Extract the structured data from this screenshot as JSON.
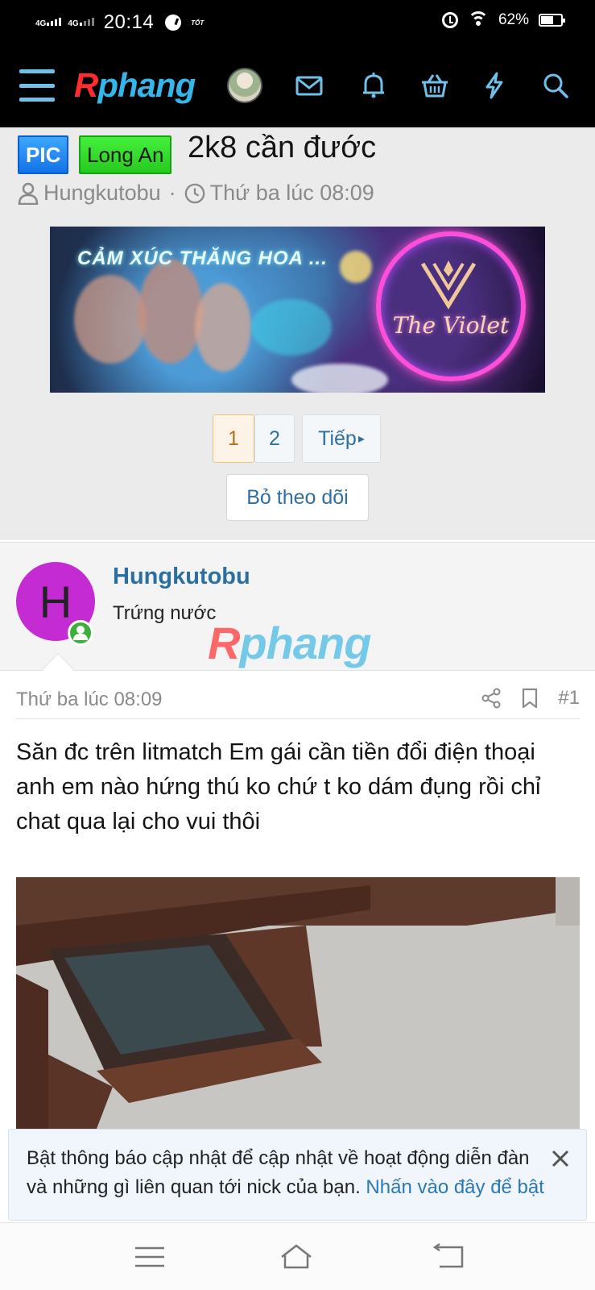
{
  "status_bar": {
    "network_1": "4G",
    "network_2": "4G",
    "time": "20:14",
    "carrier_label": "TỐT",
    "battery_percent": "62%",
    "battery_level": 0.62,
    "icons": [
      "signal-icon",
      "signal-icon",
      "messenger-icon",
      "alarm-icon",
      "wifi-icon",
      "battery-icon"
    ]
  },
  "topnav": {
    "logo_first": "R",
    "logo_rest": "phang",
    "icons": [
      "menu-icon",
      "avatar",
      "mail-icon",
      "bell-icon",
      "basket-icon",
      "lightning-icon",
      "search-icon"
    ],
    "accent_color": "#6fc1ea"
  },
  "thread": {
    "prefix_1": "PIC",
    "prefix_2": "Long An",
    "title": "2k8 cần đước",
    "author": "Hungkutobu",
    "separator": "·",
    "date": "Thứ ba lúc 08:09"
  },
  "banner": {
    "headline": "CẢM XÚC THĂNG HOA ...",
    "brand": "The Violet"
  },
  "pagination": {
    "pages": [
      "1",
      "2"
    ],
    "current_page": "1",
    "next_label": "Tiếp",
    "next_arrow": "▸"
  },
  "watch_button": "Bỏ theo dõi",
  "post_user": {
    "avatar_letter": "H",
    "avatar_color": "#c52bd3",
    "username": "Hungkutobu",
    "title": "Trứng nước",
    "watermark_first": "R",
    "watermark_rest": "phang"
  },
  "post": {
    "date": "Thứ ba lúc 08:09",
    "number": "#1",
    "body": "Săn đc trên litmatch Em gái cần tiền đổi điện thoại anh em nào hứng thú ko chứ t ko dám đụng rồi chỉ chat qua lại cho vui thôi"
  },
  "notification": {
    "text": "Bật thông báo cập nhật để cập nhật về hoạt động diễn đàn và những gì liên quan tới nick của bạn.",
    "link": "Nhấn vào đây để bật"
  }
}
